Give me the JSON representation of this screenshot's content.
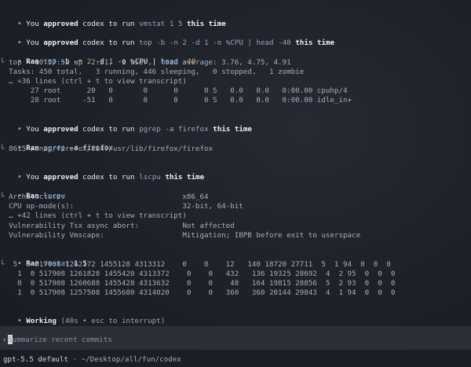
{
  "approvals": {
    "a1": {
      "pre": "You ",
      "bold": "approved",
      "mid": " codex to run ",
      "cmd": "vmstat 1 5",
      "post": "this time"
    },
    "a2": {
      "pre": "You ",
      "bold": "approved",
      "mid": " codex to run ",
      "cmd": "top -b -n 2 -d 1 -o %CPU | head -40",
      "post": "this time"
    },
    "a3": {
      "pre": "You ",
      "bold": "approved",
      "mid": " codex to run ",
      "cmd": "pgrep -a firefox",
      "post": "this time"
    },
    "a4": {
      "pre": "You ",
      "bold": "approved",
      "mid": " codex to run ",
      "cmd": "lscpu",
      "post": "this time"
    }
  },
  "run_top": {
    "ran": "Ran",
    "cmd1": "top",
    "cmd2": "-b -n",
    "n2": "2",
    "d": "-d",
    "n1": "1",
    "o": "-o %CPU",
    "pipe": "|",
    "head": "head",
    "h40": "-40",
    "out1": "└ top - 10:57:52 up  2:31,  1 user,  load average: 3.76, 4.75, 4.91",
    "out2": "  Tasks: 450 total,   3 running, 446 sleeping,   0 stopped,   1 zombie",
    "out3": "  … +36 lines (ctrl + t to view transcript)",
    "out4": "       27 root      20   0       0      0      0 S   0.0   0.0   0:00.00 cpuhp/4",
    "out5": "       28 root     -51   0       0      0      0 S   0.0   0.0   0:00.00 idle_in+"
  },
  "run_pgrep": {
    "ran": "Ran",
    "cmd1": "pgrep",
    "cmd2": "-a firefox",
    "out1": "└ 8615 /snap/firefox/8247/usr/lib/firefox/firefox"
  },
  "run_lscpu": {
    "ran": "Ran",
    "cmd1": "lscpu",
    "out1": "└ Architecture:                           x86_64",
    "out2": "  CPU op-mode(s):                         32-bit, 64-bit",
    "out3": "  … +42 lines (ctrl + t to view transcript)",
    "out4": "  Vulnerability Tsx async abort:          Not affected",
    "out5": "  Vulnerability Vmscape:                  Mitigation; IBPB before exit to userspace"
  },
  "run_vmstat": {
    "ran": "Ran",
    "cmd1": "vmstat",
    "cmd2": "1 5",
    "rows": [
      "└  5  0 517908 1262172 1455128 4313312    0    0    12   140 18720 27711  5  1 94  0  0  0",
      "    1  0 517908 1261828 1455420 4313372    0    0   432   136 19325 28692  4  2 95  0  0  0",
      "    0  0 517908 1260688 1455428 4313632    0    0    48   164 19815 28856  5  2 93  0  0  0",
      "    1  0 517908 1257508 1455680 4314020    0    0   360   360 20144 29843  4  1 94  0  0  0"
    ]
  },
  "working": {
    "label": "Working",
    "detail": "(40s • esc to interrupt)"
  },
  "input": {
    "chevron": "›",
    "placeholder": "Summarize recent commits"
  },
  "status": {
    "model": "gpt-5.5 default",
    "sep": " · ",
    "path": "~/Desktop/all/fun/codex"
  },
  "bullet": "•"
}
